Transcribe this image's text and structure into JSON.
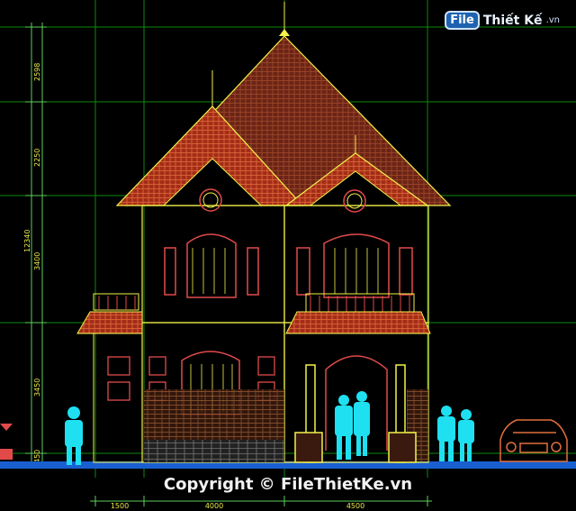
{
  "watermark": {
    "badge": "File",
    "name": "Thiết Kế",
    "domain": ".vn"
  },
  "dimensions": {
    "vertical": [
      "2598",
      "2250",
      "3400",
      "3450",
      "12340",
      "450"
    ],
    "horizontal": [
      "1500",
      "4000",
      "4500"
    ]
  },
  "copyright": "Copyright © FileThietKe.vn",
  "colors": {
    "background": "#000000",
    "grid": "#0a8a0a",
    "outline": "#f2f24a",
    "roof_back": "#7a2a1a",
    "roof_front": "#b4321c",
    "window_frame": "#e24a4a",
    "people": "#1ee0f0",
    "car": "#c85a2a",
    "ground": "#1e6ad8"
  },
  "icons": [
    "roof-icon",
    "window-icon",
    "person-icon",
    "car-icon"
  ]
}
